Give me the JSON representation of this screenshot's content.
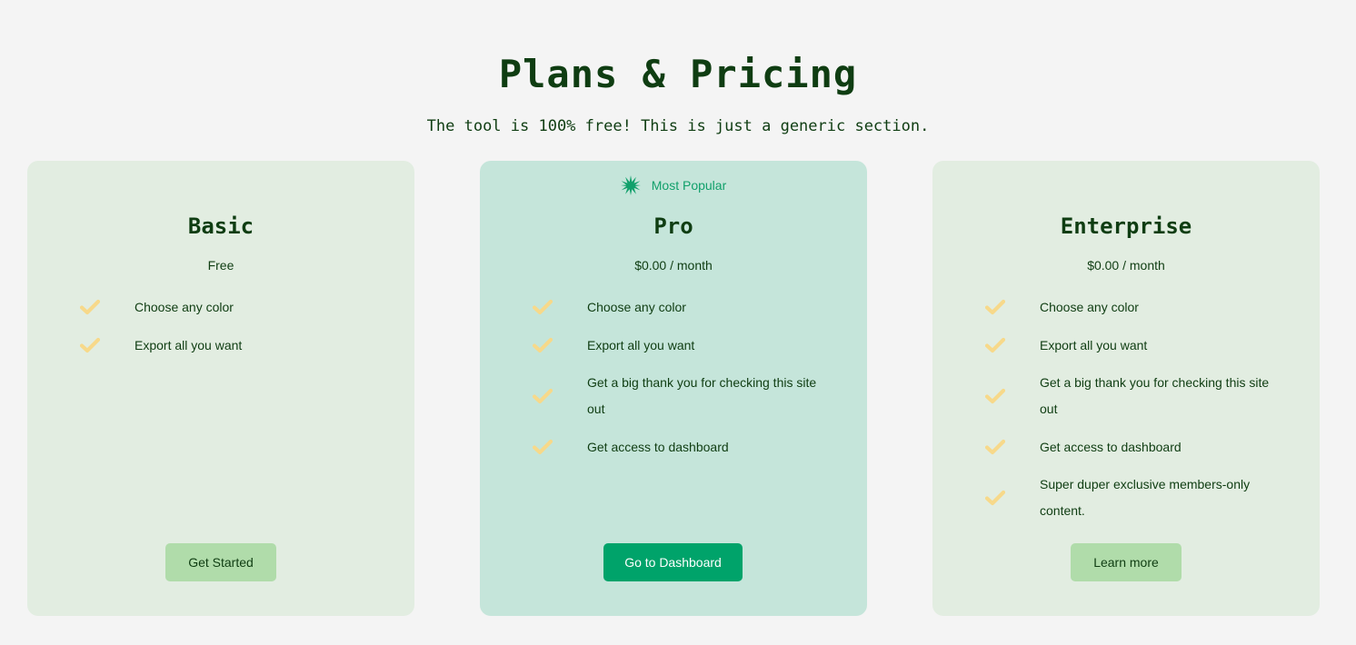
{
  "header": {
    "title": "Plans & Pricing",
    "subtitle": "The tool is 100% free! This is just a generic section."
  },
  "colors": {
    "background": "#f4f4f4",
    "card": "#e2ede1",
    "card_featured": "#c5e5da",
    "text": "#0f3d12",
    "accent": "#00a36a",
    "check": "#f7d98a",
    "button_light": "#b0dcaa"
  },
  "plans": [
    {
      "name": "Basic",
      "price": "Free",
      "features": [
        "Choose any color",
        "Export all you want"
      ],
      "button_label": "Get Started"
    },
    {
      "badge": "Most Popular",
      "badge_icon": "starburst-icon",
      "name": "Pro",
      "price": "$0.00 / month",
      "features": [
        "Choose any color",
        "Export all you want",
        "Get a big thank you for checking this site out",
        "Get access to dashboard"
      ],
      "button_label": "Go to Dashboard"
    },
    {
      "name": "Enterprise",
      "price": "$0.00 / month",
      "features": [
        "Choose any color",
        "Export all you want",
        "Get a big thank you for checking this site out",
        "Get access to dashboard",
        "Super duper exclusive members-only content."
      ],
      "button_label": "Learn more"
    }
  ]
}
